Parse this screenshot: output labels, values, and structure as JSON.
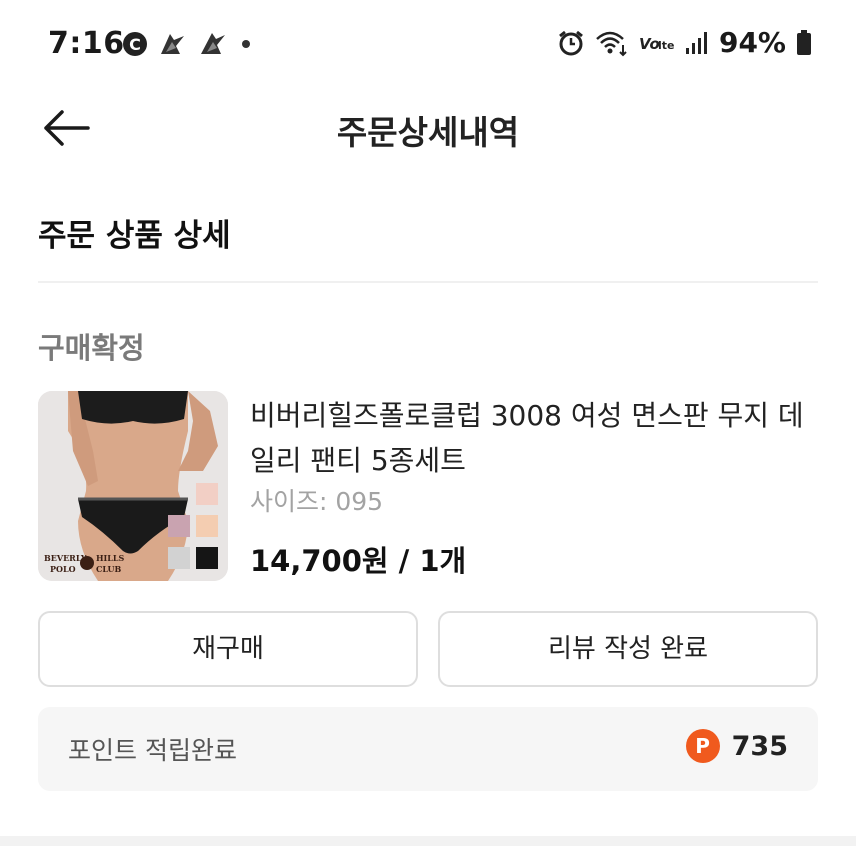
{
  "status_bar": {
    "time": "7:16",
    "left_icons": [
      "c-circle-icon",
      "notification-bird-icon",
      "notification-bird-icon",
      "dot-icon"
    ],
    "right_icons": [
      "alarm-icon",
      "wifi-icon",
      "volte-icon",
      "signal-icon"
    ],
    "battery_text": "94%"
  },
  "header": {
    "title": "주문상세내역",
    "back_icon": "arrow-left-icon"
  },
  "section": {
    "title": "주문 상품 상세",
    "status": "구매확정"
  },
  "product": {
    "name": "비버리힐즈폴로클럽 3008 여성 면스판 무지 데일리 팬티 5종세트",
    "option": "사이즈: 095",
    "price": "14,700원 / 1개",
    "image_brand_lines": [
      "BEVERLY",
      "HILLS",
      "POLO",
      "CLUB"
    ],
    "swatch_colors": [
      "#f2cfc5",
      "#c9a3b0",
      "#f4cdb1",
      "#d2d2d2",
      "#151515"
    ]
  },
  "buttons": {
    "rebuy": "재구매",
    "review": "리뷰 작성 완료"
  },
  "points": {
    "label": "포인트 적립완료",
    "icon_letter": "P",
    "value": "735"
  },
  "colors": {
    "accent": "#f05a1e"
  }
}
